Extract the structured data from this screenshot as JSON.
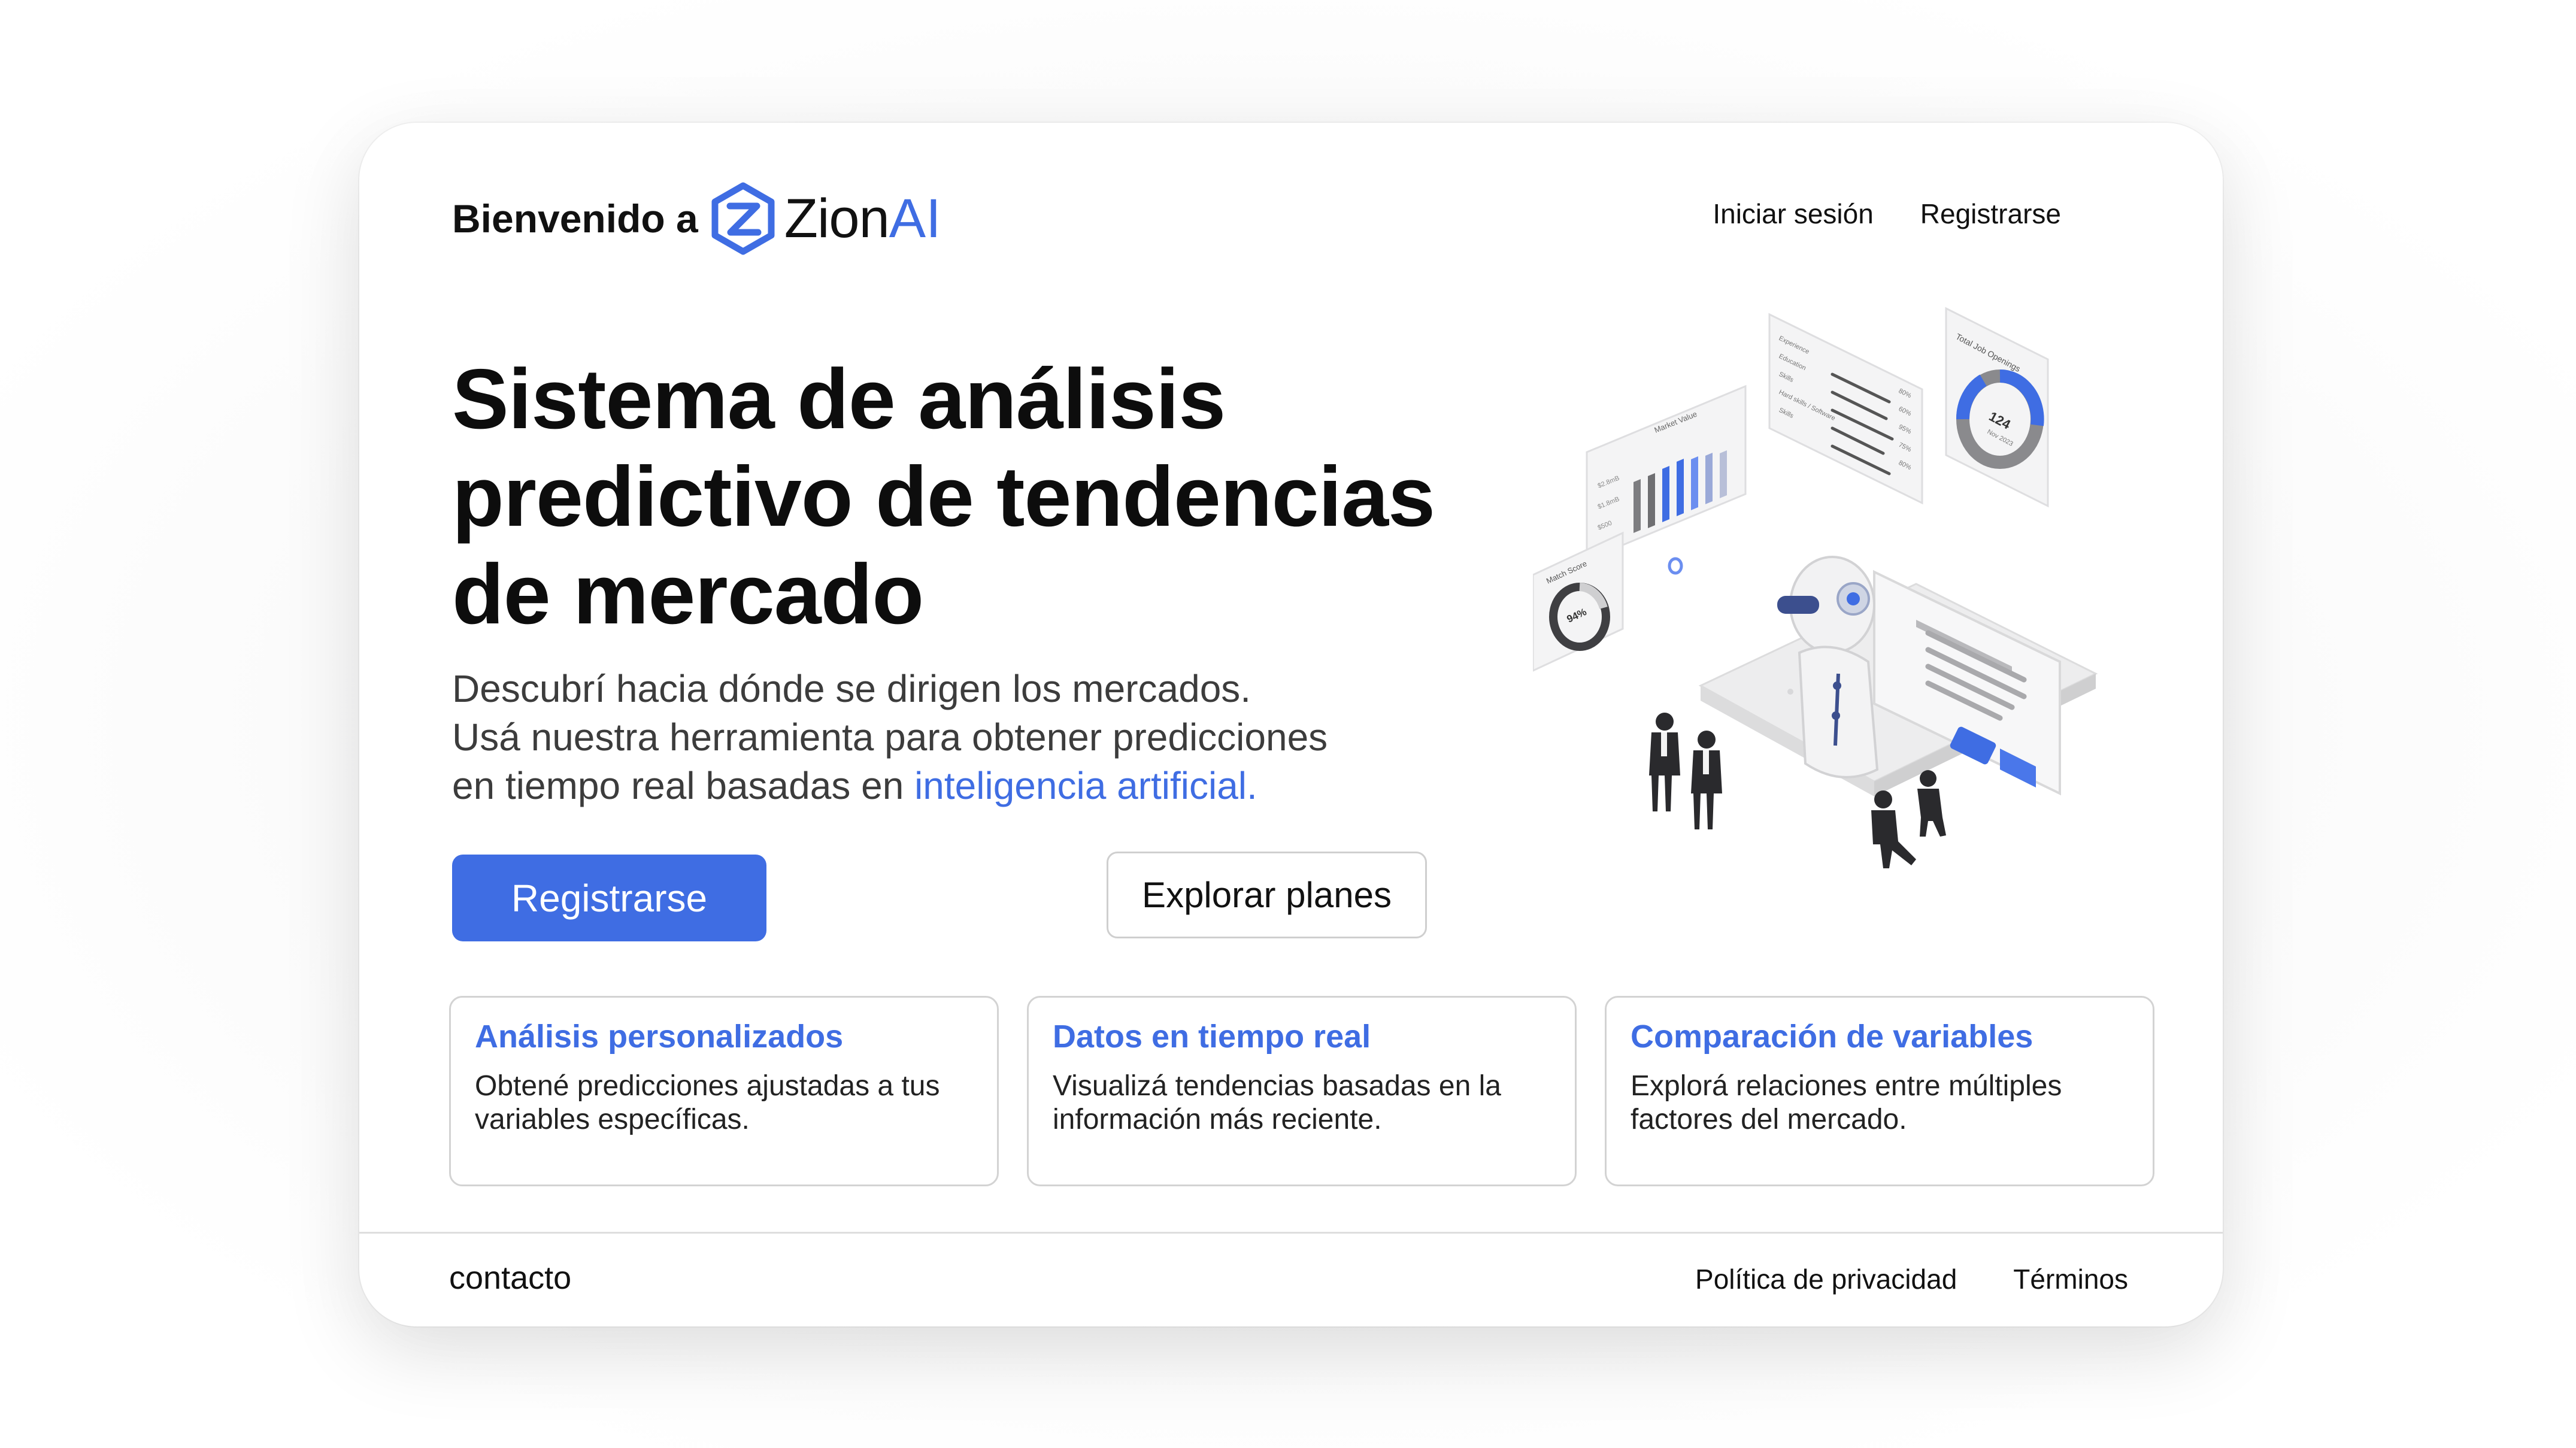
{
  "brand": {
    "welcome": "Bienvenido a",
    "name_primary": "Zion",
    "name_accent": "AI",
    "logo_icon": "hexagon-z-logo-icon"
  },
  "nav": {
    "login": "Iniciar sesión",
    "register": "Registrarse"
  },
  "hero": {
    "title_lines": [
      "Sistema de análisis",
      "predictivo de tendencias",
      "de mercado"
    ],
    "subtitle_lines": [
      "Descubrí hacia dónde se dirigen los mercados.",
      "Usá nuestra herramienta para obtener predicciones"
    ],
    "subtitle_last_prefix": "en tiempo real basadas en ",
    "subtitle_highlight": "inteligencia artificial.",
    "primary_button": "Registrarse",
    "secondary_button": "Explorar planes"
  },
  "illustration": {
    "icon": "ai-analytics-illustration",
    "bar_panel_title": "Market Value",
    "bar_panel_ticks": [
      "$2.8mB",
      "$1.8mB",
      "$500"
    ],
    "list_panel_rows": [
      "Experience",
      "Education",
      "Skills",
      "Hard skills / Software",
      "Skills"
    ],
    "list_panel_values": [
      "80%",
      "60%",
      "95%",
      "75%",
      "80%"
    ],
    "donut_panel_title": "Total Job Openings",
    "donut_panel_value": "124",
    "donut_panel_caption": "Nov 2023",
    "match_panel_title": "Match Score",
    "match_panel_value": "94%"
  },
  "features": [
    {
      "title": "Análisis personalizados",
      "desc_lines": [
        "Obtené predicciones ajustadas a tus",
        "variables específicas."
      ]
    },
    {
      "title": "Datos en tiempo real",
      "desc_lines": [
        "Visualizá tendencias basadas en la",
        "información más reciente."
      ]
    },
    {
      "title": "Comparación de variables",
      "desc_lines": [
        "Explorá relaciones entre múltiples",
        "factores del mercado."
      ]
    }
  ],
  "footer": {
    "contact": "contacto",
    "privacy": "Política de privacidad",
    "terms": "Términos"
  },
  "colors": {
    "accent": "#3f6de3",
    "text": "#111111",
    "muted_text": "#3c3c3c",
    "border": "#d3d3d3"
  }
}
